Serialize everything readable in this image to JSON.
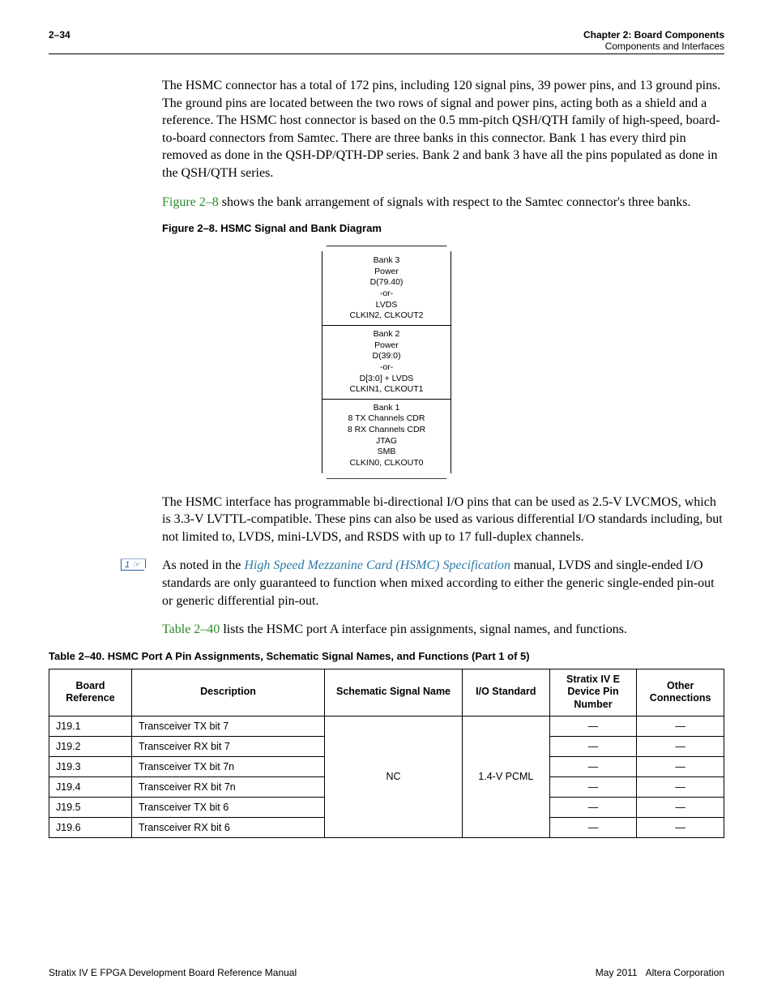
{
  "header": {
    "page_num": "2–34",
    "chapter": "Chapter 2: Board Components",
    "section": "Components and Interfaces"
  },
  "paragraphs": {
    "p1": "The HSMC connector has a total of 172 pins, including 120 signal pins, 39 power pins, and 13 ground pins. The ground pins are located between the two rows of signal and power pins, acting both as a shield and a reference. The HSMC host connector is based on the 0.5 mm-pitch QSH/QTH family of high-speed, board-to-board connectors from Samtec. There are three banks in this connector. Bank 1 has every third pin removed as done in the QSH-DP/QTH-DP series. Bank 2 and bank 3 have all the pins populated as done in the QSH/QTH series.",
    "p2_link": "Figure 2–8",
    "p2_rest": " shows the bank arrangement of signals with respect to the Samtec connector's three banks.",
    "p3": "The HSMC interface has programmable bi-directional I/O pins that can be used as 2.5-V LVCMOS, which is 3.3-V LVTTL-compatible. These pins can also be used as various differential I/O standards including, but not limited to, LVDS, mini-LVDS, and RSDS with up to 17 full-duplex channels.",
    "p4_pre": "As noted in the ",
    "p4_link": "High Speed Mezzanine Card (HSMC) Specification",
    "p4_post": " manual, LVDS and single-ended I/O standards are only guaranteed to function when mixed according to either the generic single-ended pin-out or generic differential pin-out.",
    "p5_link": "Table 2–40",
    "p5_rest": " lists the HSMC port A interface pin assignments, signal names, and functions."
  },
  "figure_caption": "Figure 2–8. HSMC Signal and Bank Diagram",
  "diagram": {
    "bank3": [
      "Bank 3",
      "Power",
      "D(79.40)",
      "-or-",
      "LVDS",
      "CLKIN2, CLKOUT2"
    ],
    "bank2": [
      "Bank 2",
      "Power",
      "D(39:0)",
      "-or-",
      "D[3:0] + LVDS",
      "CLKIN1, CLKOUT1"
    ],
    "bank1": [
      "Bank 1",
      "8 TX Channels CDR",
      "8 RX Channels CDR",
      "JTAG",
      "SMB",
      "CLKIN0, CLKOUT0"
    ]
  },
  "table_caption": "Table 2–40. HSMC Port A Pin Assignments, Schematic Signal Names, and Functions (Part 1 of 5)",
  "table": {
    "headers": [
      "Board Reference",
      "Description",
      "Schematic Signal Name",
      "I/O Standard",
      "Stratix IV E Device Pin Number",
      "Other Connections"
    ],
    "schematic_signal": "NC",
    "io_standard": "1.4-V PCML",
    "rows": [
      {
        "ref": "J19.1",
        "desc": "Transceiver TX bit 7",
        "pin": "—",
        "other": "—"
      },
      {
        "ref": "J19.2",
        "desc": "Transceiver RX bit 7",
        "pin": "—",
        "other": "—"
      },
      {
        "ref": "J19.3",
        "desc": "Transceiver TX bit 7n",
        "pin": "—",
        "other": "—"
      },
      {
        "ref": "J19.4",
        "desc": "Transceiver RX bit 7n",
        "pin": "—",
        "other": "—"
      },
      {
        "ref": "J19.5",
        "desc": "Transceiver TX bit 6",
        "pin": "—",
        "other": "—"
      },
      {
        "ref": "J19.6",
        "desc": "Transceiver RX bit 6",
        "pin": "—",
        "other": "—"
      }
    ]
  },
  "footer": {
    "left": "Stratix IV E FPGA Development Board Reference Manual",
    "right_date": "May 2011",
    "right_corp": "Altera Corporation"
  }
}
